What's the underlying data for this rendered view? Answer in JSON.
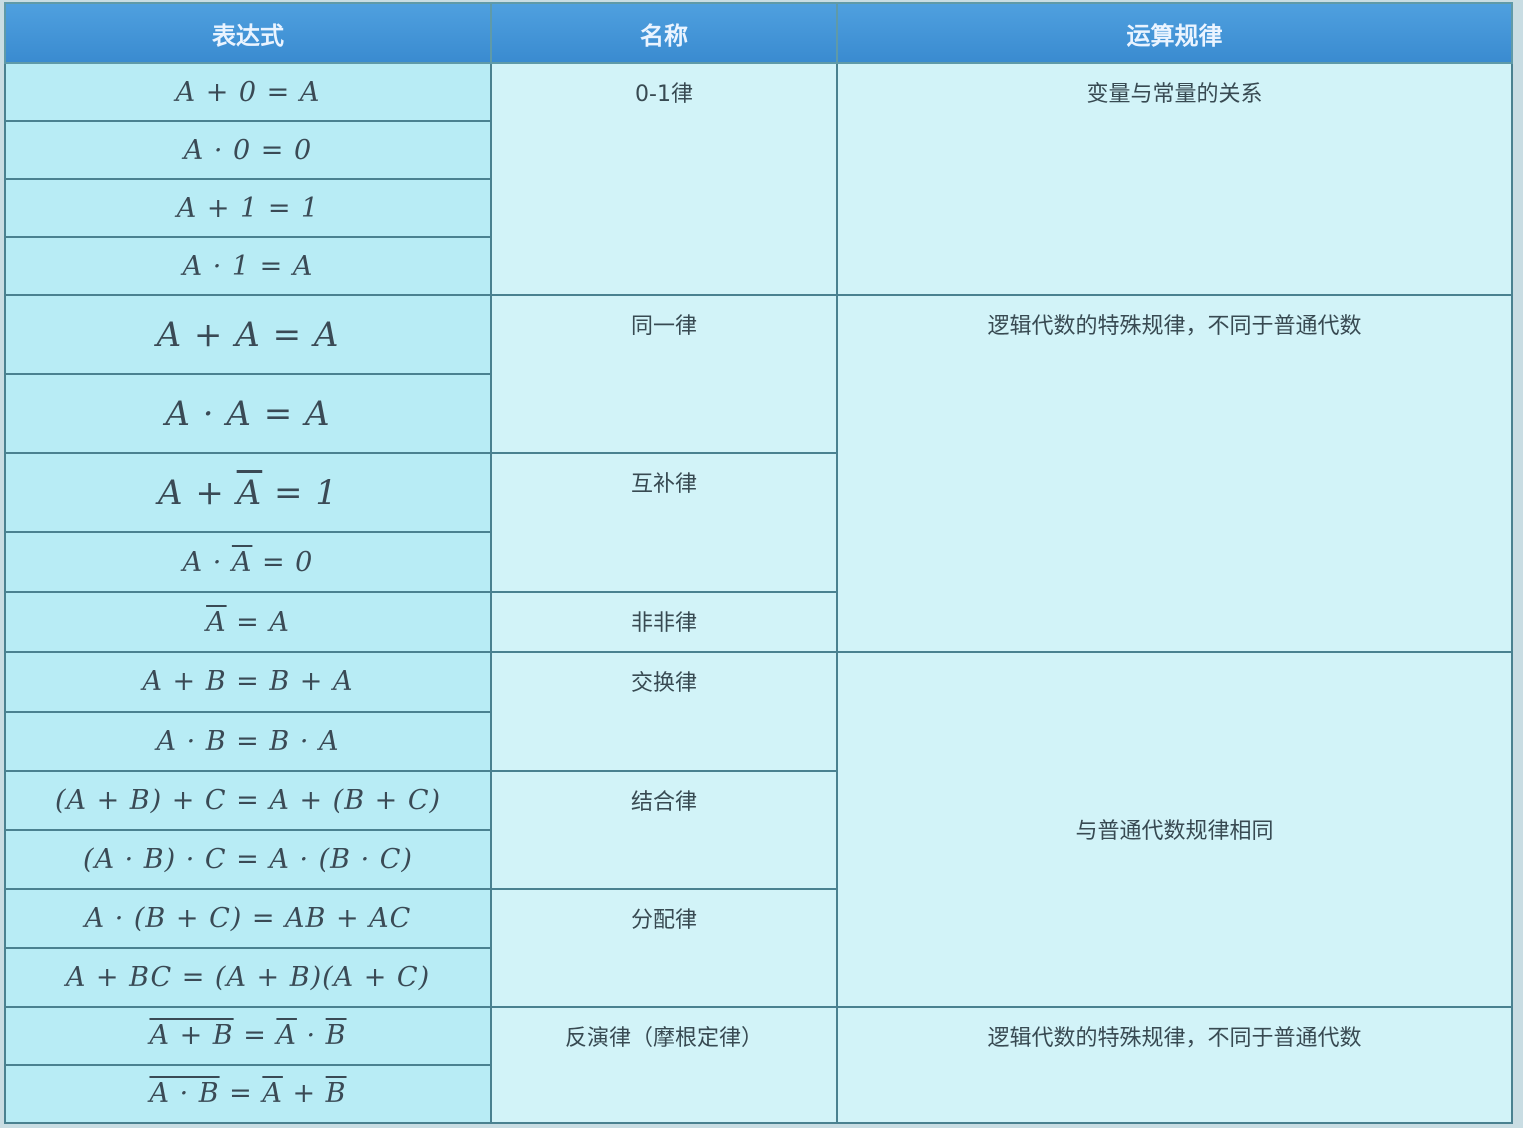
{
  "table": {
    "headers": [
      "表达式",
      "名称",
      "运算规律"
    ],
    "rows": [
      {
        "expr": [
          {
            "t": "A + 0 = A"
          }
        ]
      },
      {
        "expr": [
          {
            "t": "A · 0 = 0"
          }
        ]
      },
      {
        "expr": [
          {
            "t": "A + 1 = 1"
          }
        ]
      },
      {
        "expr": [
          {
            "t": "A · 1 = A"
          }
        ]
      },
      {
        "expr": [
          {
            "t": "A + A = A"
          }
        ],
        "big": true
      },
      {
        "expr": [
          {
            "t": "A · A = A"
          }
        ],
        "big": true
      },
      {
        "expr": [
          {
            "t": "A + "
          },
          {
            "t": "A",
            "over": true
          },
          {
            "t": " = 1"
          }
        ],
        "big": true
      },
      {
        "expr": [
          {
            "t": "A · "
          },
          {
            "t": "A",
            "over": true
          },
          {
            "t": " = 0"
          }
        ]
      },
      {
        "expr": [
          {
            "t": "A",
            "over": true
          },
          {
            "t": " = A"
          }
        ]
      },
      {
        "expr": [
          {
            "t": "A + B = B + A"
          }
        ]
      },
      {
        "expr": [
          {
            "t": "A · B = B · A"
          }
        ]
      },
      {
        "expr": [
          {
            "t": "(A + B) + C = A + (B + C)"
          }
        ]
      },
      {
        "expr": [
          {
            "t": "(A · B) · C = A · (B · C)"
          }
        ]
      },
      {
        "expr": [
          {
            "t": "A · (B + C) = AB + AC"
          }
        ]
      },
      {
        "expr": [
          {
            "t": "A + BC = (A + B)(A + C)"
          }
        ]
      },
      {
        "expr": [
          {
            "t": "A + B",
            "over": true
          },
          {
            "t": " = "
          },
          {
            "t": "A",
            "over": true
          },
          {
            "t": " · "
          },
          {
            "t": "B",
            "over": true
          }
        ]
      },
      {
        "expr": [
          {
            "t": "A · B",
            "over": true
          },
          {
            "t": " = "
          },
          {
            "t": "A",
            "over": true
          },
          {
            "t": " + "
          },
          {
            "t": "B",
            "over": true
          }
        ]
      }
    ],
    "names": [
      "0-1律",
      "同一律",
      "互补律",
      "非非律",
      "交换律",
      "结合律",
      "分配律",
      "反演律（摩根定律）"
    ],
    "rules": [
      "变量与常量的关系",
      "逻辑代数的特殊规律，不同于普通代数",
      "与普通代数规律相同",
      "逻辑代数的特殊规律，不同于普通代数"
    ]
  }
}
